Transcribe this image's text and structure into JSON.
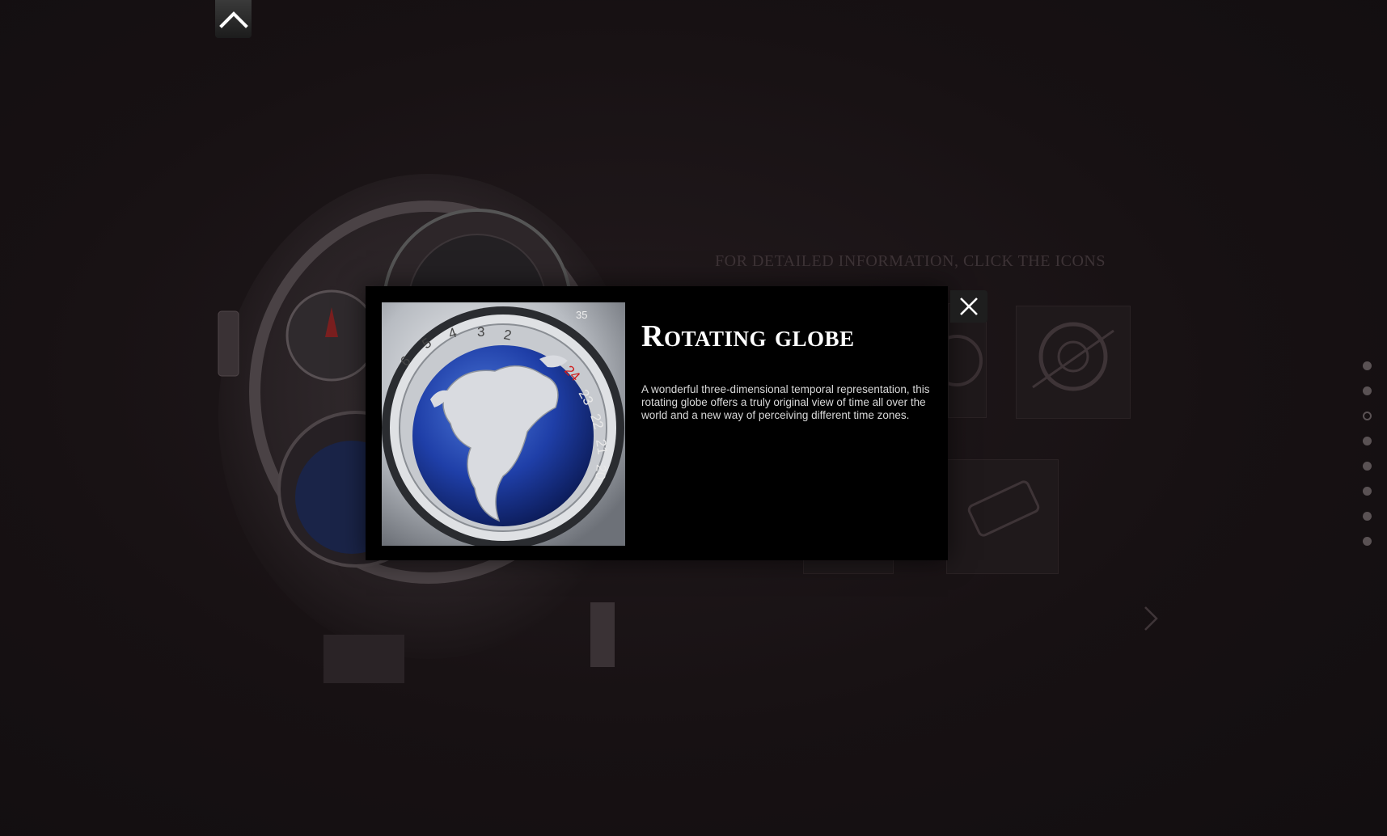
{
  "background": {
    "hint_text": "FOR DETAILED INFORMATION, CLICK THE ICONS"
  },
  "modal": {
    "title": "Rotating globe",
    "description": "A wonderful three-dimensional temporal representation, this rotating globe offers a truly original view of time all over the world and a new way of perceiving different time zones.",
    "image_alt": "globe-detail-image"
  },
  "side_nav": {
    "count": 8,
    "active_index": 2
  },
  "icons": {
    "up": "chevron-up-icon",
    "close": "close-icon",
    "next": "chevron-right-icon"
  },
  "colors": {
    "background": "#161113",
    "modal_bg": "#000000",
    "title": "#ffffff",
    "globe_blue": "#1f3fa8",
    "accent_red": "#d01818"
  }
}
